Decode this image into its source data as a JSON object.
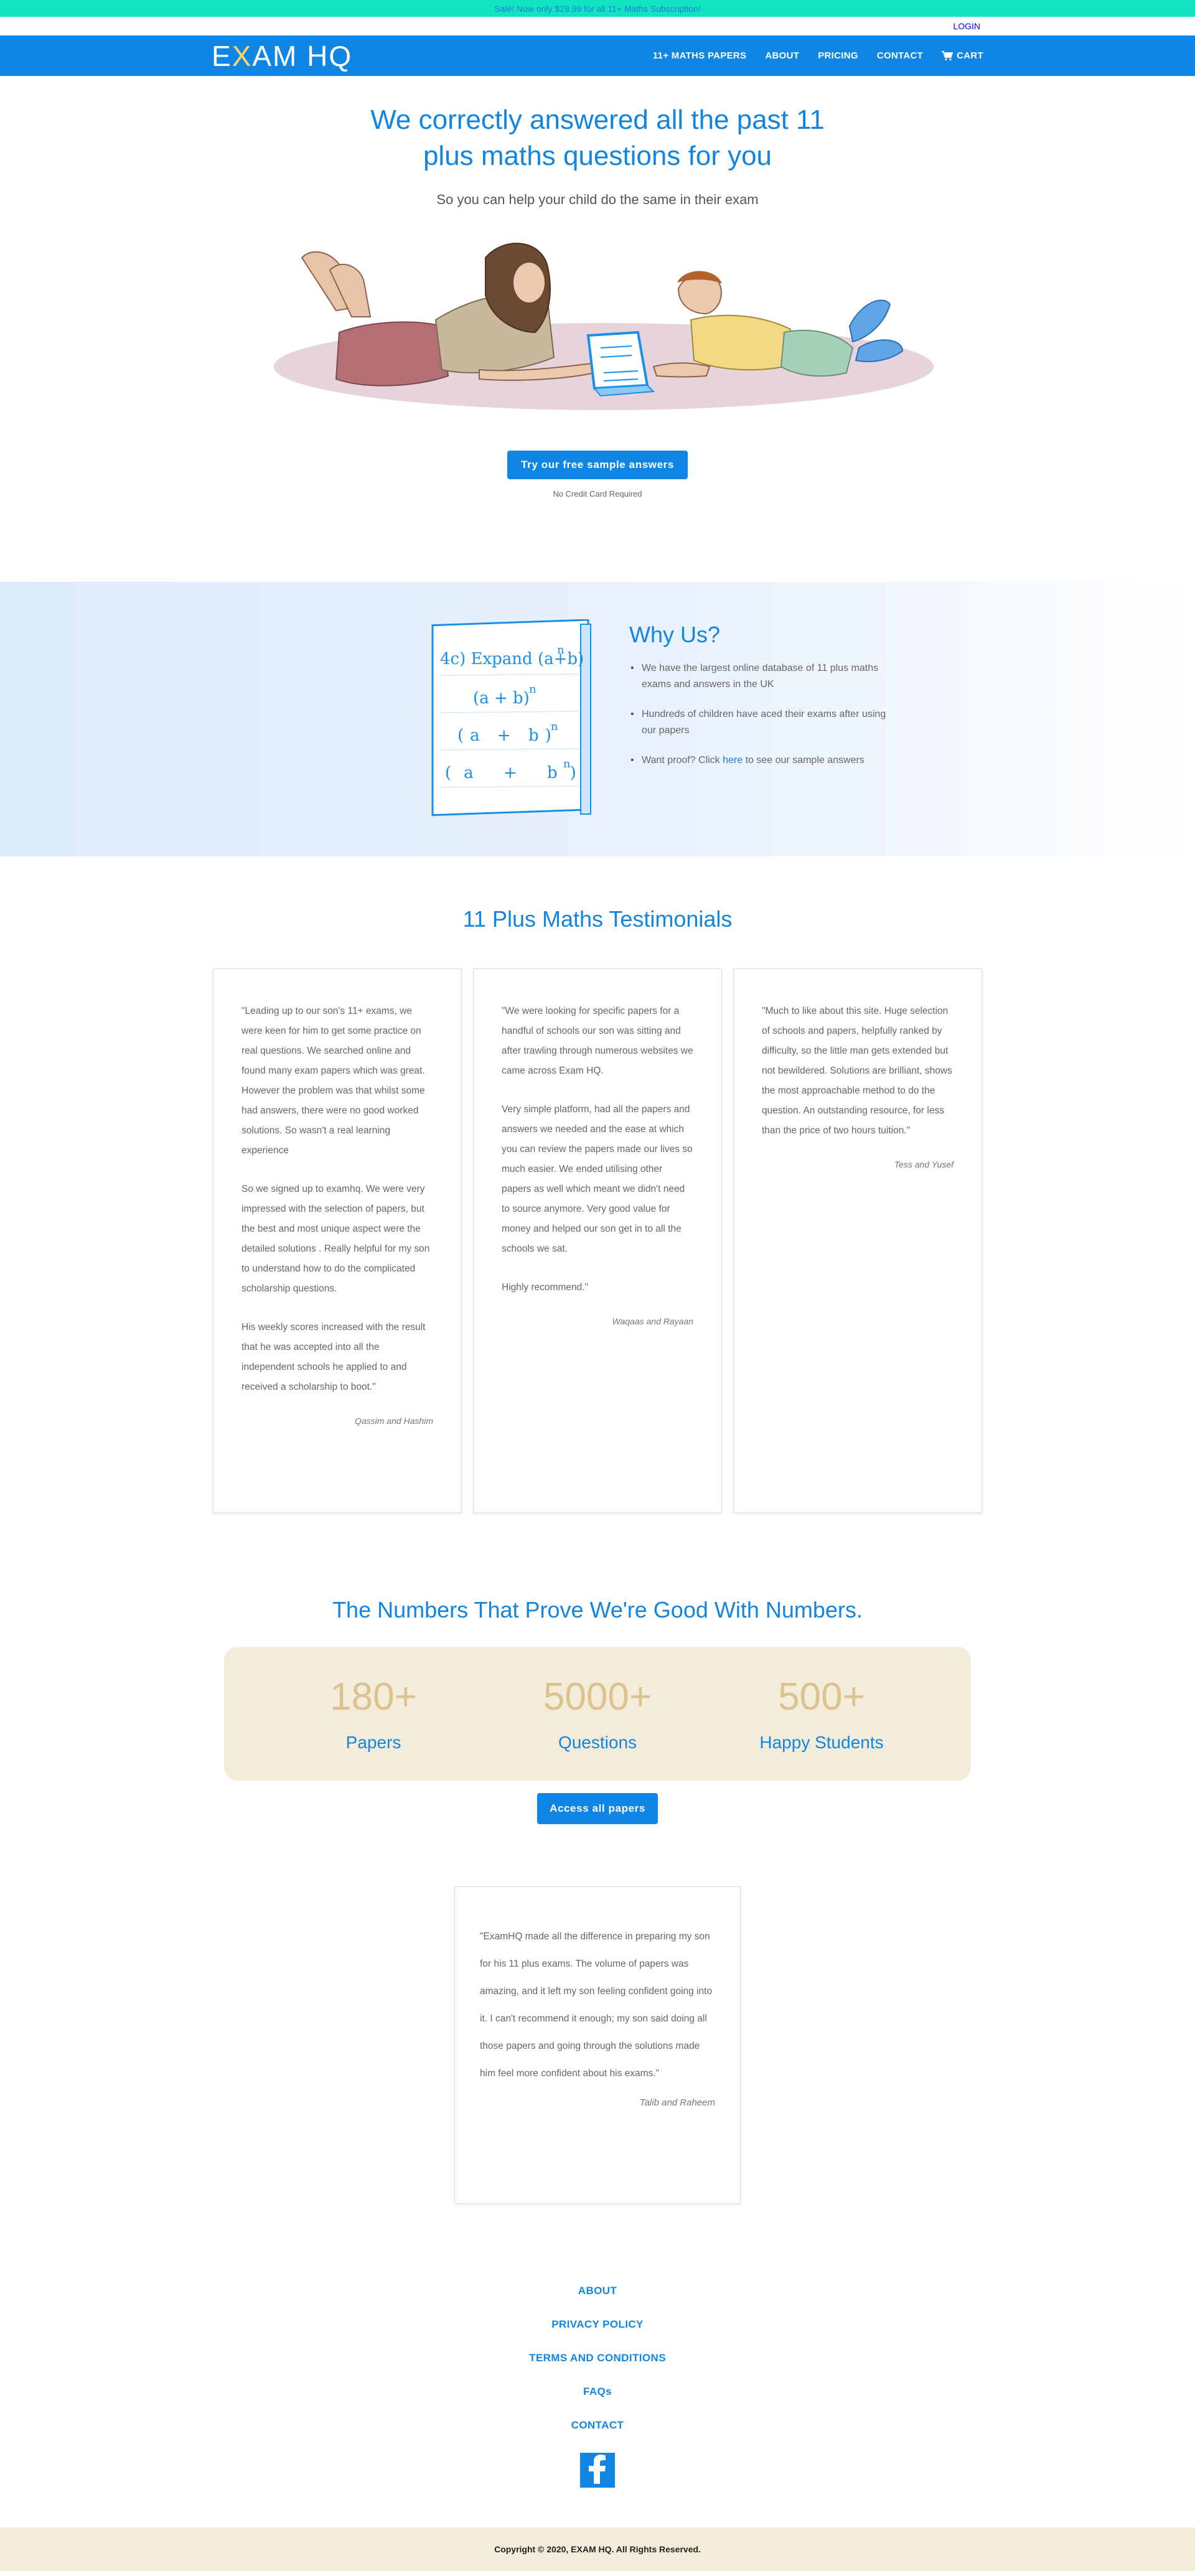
{
  "promo": {
    "text": "Sale! Now only $29.99 for all 11+ Maths Subscription!"
  },
  "header": {
    "login": "LOGIN",
    "logo": {
      "part1": "E",
      "x": "X",
      "part2": "AM H",
      "q": "Q"
    },
    "nav": [
      "11+ MATHS PAPERS",
      "ABOUT",
      "PRICING",
      "CONTACT",
      "CART"
    ]
  },
  "hero": {
    "title": "We correctly answered all the past 11 plus maths questions for you",
    "subtitle": "So you can help your child do the same in their exam",
    "cta": "Try our free sample answers",
    "note": "No Credit Card Required"
  },
  "why": {
    "notebook": {
      "line1": "4c) Expand (a+b)",
      "sup": "n",
      "row": "(a + b)"
    },
    "title": "Why Us?",
    "items": [
      {
        "text": "We have the largest online database of 11 plus maths exams and answers in the UK"
      },
      {
        "text": "Hundreds of children have aced their exams after using our papers"
      },
      {
        "pre": "Want proof? Click ",
        "link": "here",
        "post": " to see our sample answers"
      }
    ]
  },
  "testimonials": {
    "title": "11 Plus Maths Testimonials",
    "cards": [
      {
        "paragraphs": [
          "\"Leading up to our son's 11+ exams, we were keen for him to get some practice on real questions. We searched online and found many exam papers which was great. However the problem was that whilst some had answers, there were no good worked solutions. So wasn't a real learning experience",
          "So we signed up to examhq. We were very impressed with the selection of papers, but the best and most unique aspect were the detailed solutions . Really helpful for my son to understand how to do the complicated scholarship questions.",
          "His weekly scores increased with the result that he was accepted into all the independent schools he applied to and received a scholarship to boot.\""
        ],
        "author": "Qassim and Hashim"
      },
      {
        "paragraphs": [
          "\"We were looking for specific papers for a handful of schools our son was sitting and after trawling through numerous websites we came across Exam HQ.",
          " Very simple platform, had all the papers and answers we needed and the ease at which you can review the papers made our lives so much easier. We ended utilising other papers as well which meant we didn't need to source anymore. Very good value for money and helped our son get in to all the schools we sat.",
          "Highly recommend.\""
        ],
        "author": "Waqaas and Rayaan"
      },
      {
        "paragraphs": [
          "\"Much to like about this site. Huge selection of schools and papers, helpfully ranked by difficulty, so the little man gets extended but not bewildered. Solutions are brilliant, shows the most approachable method to do the question. An outstanding resource, for less than the price of two hours tuition.\""
        ],
        "author": "Tess and Yusef"
      }
    ]
  },
  "numbers": {
    "title": "The Numbers That Prove We're Good With Numbers.",
    "stats": [
      {
        "value": "180+",
        "label": "Papers"
      },
      {
        "value": "5000+",
        "label": "Questions"
      },
      {
        "value": "500+",
        "label": "Happy Students"
      }
    ],
    "cta": "Access all papers"
  },
  "single_testimonial": {
    "text": "\"ExamHQ made all the difference in preparing my son for his 11 plus exams. The volume of papers was amazing, and it left my son feeling confident going into it. I can't recommend it enough; my son said doing all those papers and going through the solutions made him feel more confident about his exams.\"",
    "author": "Talib and Raheem"
  },
  "footer": {
    "links": [
      "ABOUT",
      "PRIVACY POLICY",
      "TERMS AND CONDITIONS",
      "FAQs",
      "CONTACT"
    ],
    "copyright": "Copyright © 2020, EXAM HQ.  All Rights Reserved."
  },
  "colors": {
    "brand_blue": "#0f85e4",
    "promo_teal": "#11e4c1",
    "cream": "#f4ecda",
    "gold": "#dcc28c"
  }
}
